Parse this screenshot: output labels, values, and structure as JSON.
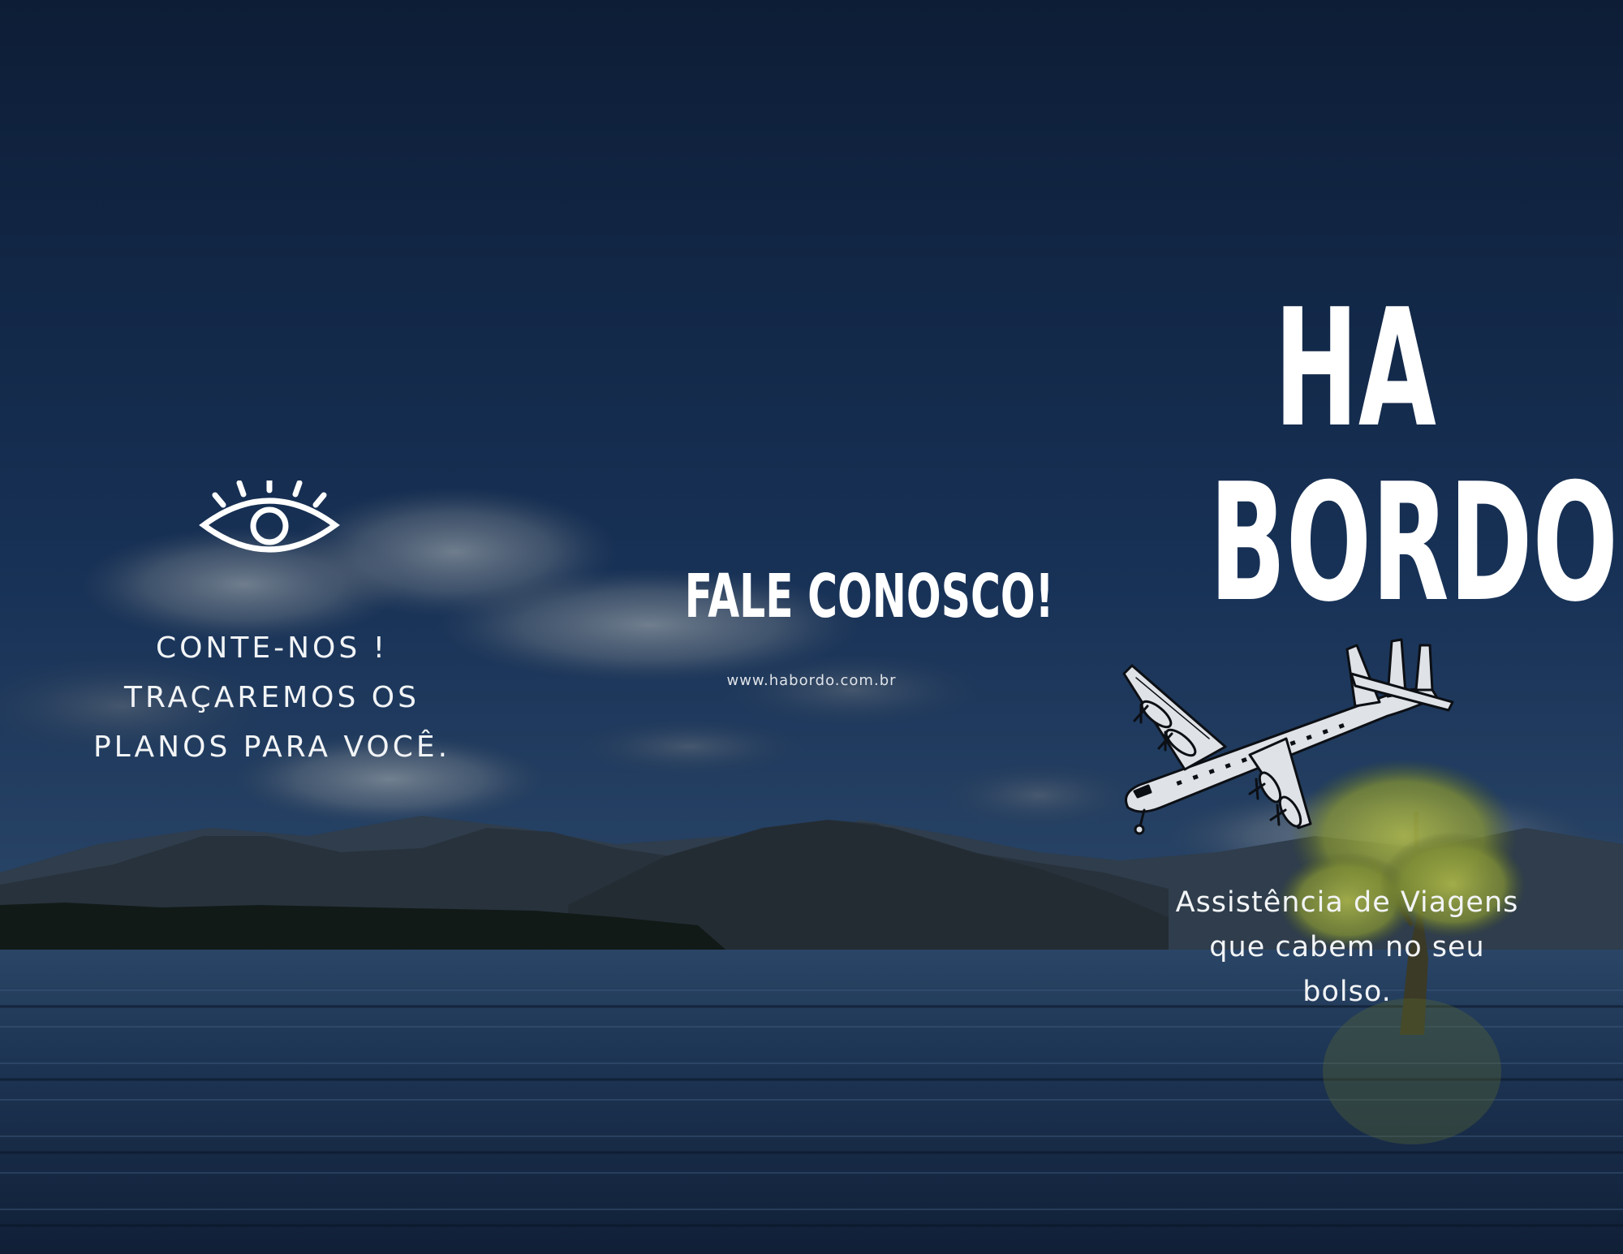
{
  "colors": {
    "sky_top": "#0e1f3a",
    "sky_mid": "#1f3a5c",
    "water": "#1b2f4d",
    "mountain": "#2b3642",
    "tree": "#8a9a3c",
    "text": "#ffffff"
  },
  "left_panel": {
    "icon": "eye-icon",
    "lines": [
      "CONTE-NOS !",
      "TRAÇAREMOS OS",
      "PLANOS PARA VOCÊ."
    ]
  },
  "center_panel": {
    "heading": "FALE CONOSCO!",
    "url": "www.habordo.com.br"
  },
  "right_panel": {
    "brand_line1": "HA",
    "brand_line2": "BORDO",
    "icon": "airplane-icon",
    "tagline_lines": [
      "Assistência de Viagens",
      "que cabem no seu",
      "bolso."
    ]
  }
}
